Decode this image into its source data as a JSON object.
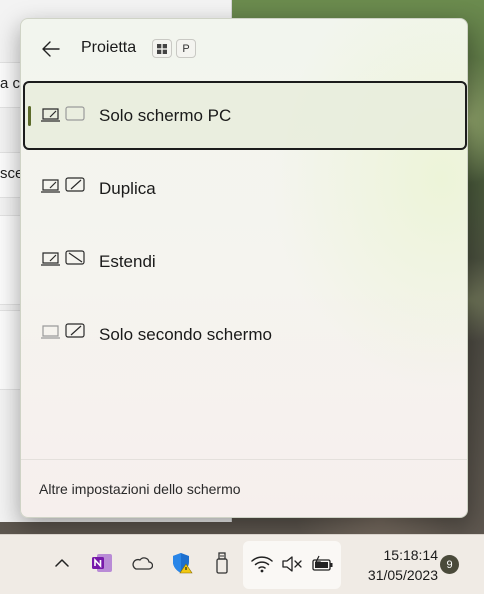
{
  "background_window": {
    "rows": [
      {
        "text": "a co"
      },
      {
        "text": "sce"
      }
    ]
  },
  "flyout": {
    "title": "Proietta",
    "shortcut_keys": [
      "⊞",
      "P"
    ],
    "options": [
      {
        "label": "Solo schermo PC",
        "selected": true,
        "icon": "pc-screen-only-icon"
      },
      {
        "label": "Duplica",
        "selected": false,
        "icon": "duplicate-icon"
      },
      {
        "label": "Estendi",
        "selected": false,
        "icon": "extend-icon"
      },
      {
        "label": "Solo secondo schermo",
        "selected": false,
        "icon": "second-screen-only-icon"
      }
    ],
    "footer_link": "Altre impostazioni dello schermo"
  },
  "taskbar": {
    "icons": [
      "chevron-up-icon",
      "onenote-icon",
      "onedrive-icon",
      "security-shield-icon",
      "usb-drive-icon",
      "wifi-icon",
      "volume-muted-icon",
      "battery-charging-icon"
    ],
    "time": "15:18:14",
    "date": "31/05/2023",
    "notification_count": "9"
  },
  "colors": {
    "accent": "#5c6b2a",
    "selected_border": "#1c1c1c"
  }
}
